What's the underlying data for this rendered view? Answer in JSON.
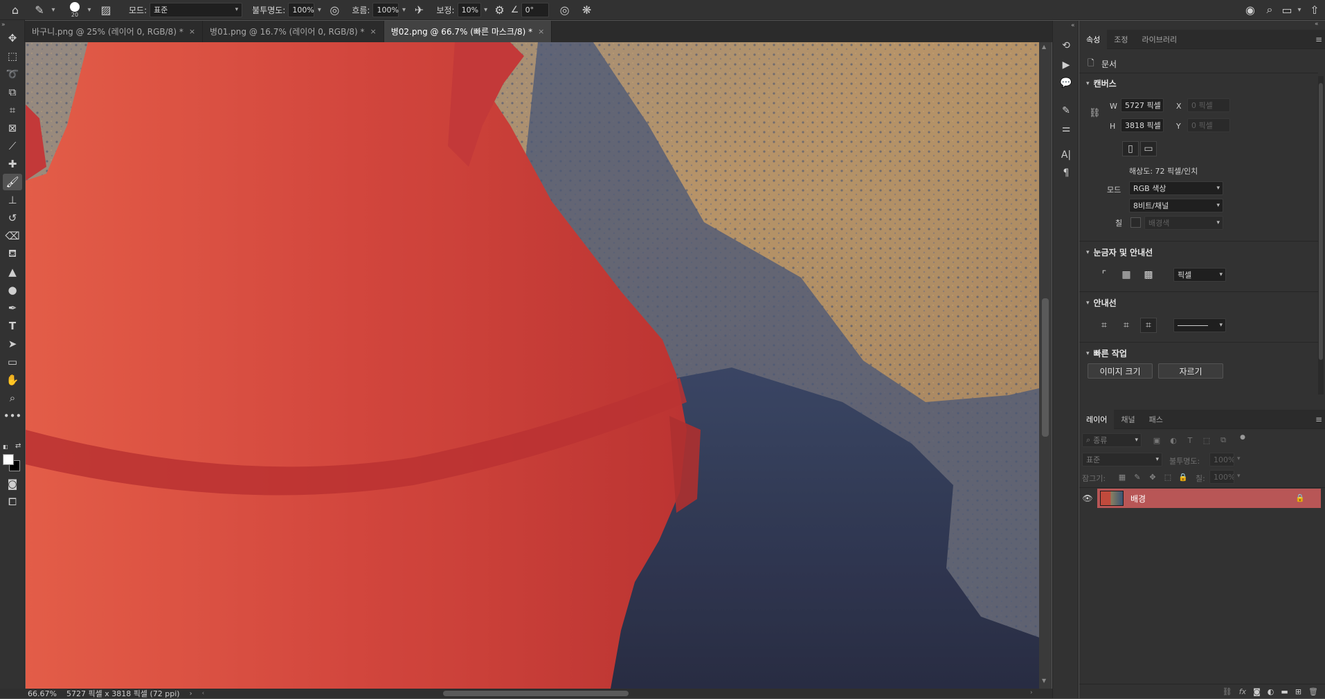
{
  "options_bar": {
    "brush_size": "20",
    "mode_label": "모드:",
    "mode_value": "표준",
    "opacity_label": "불투명도:",
    "opacity_value": "100%",
    "flow_label": "흐름:",
    "flow_value": "100%",
    "smoothing_label": "보정:",
    "smoothing_value": "10%",
    "angle_value": "0°"
  },
  "tabs": [
    {
      "label": "바구니.png @ 25% (레이어 0, RGB/8) *",
      "close": "×"
    },
    {
      "label": "병01.png @ 16.7% (레이어 0, RGB/8) *",
      "close": "×"
    },
    {
      "label": "병02.png @ 66.7% (빠른 마스크/8) *",
      "close": "×"
    }
  ],
  "status_bar": {
    "zoom": "66.67%",
    "doc_info": "5727 픽셀 x 3818 픽셀 (72 ppi)"
  },
  "properties_panel": {
    "tabs": [
      "속성",
      "조정",
      "라이브러리"
    ],
    "doc_label": "문서",
    "canvas": {
      "title": "캔버스",
      "w_label": "W",
      "w_value": "5727 픽셀",
      "h_label": "H",
      "h_value": "3818 픽셀",
      "x_label": "X",
      "x_placeholder": "0 픽셀",
      "y_label": "Y",
      "y_placeholder": "0 픽셀",
      "resolution": "해상도: 72 픽셀/인치",
      "mode_label": "모드",
      "mode_value": "RGB 색상",
      "bits_value": "8비트/채널",
      "fill_label": "칠",
      "fill_value": "배경색"
    },
    "rulers": {
      "title": "눈금자 및 안내선",
      "unit": "픽셀"
    },
    "guides": {
      "title": "안내선"
    },
    "quick_actions": {
      "title": "빠른 작업",
      "image_size_button": "이미지 크기",
      "crop_button": "자르기"
    }
  },
  "layers_panel": {
    "tabs": [
      "레이어",
      "채널",
      "패스"
    ],
    "filter_placeholder": "종류",
    "blend_mode": "표준",
    "opacity_label": "불투명도:",
    "opacity_value": "100%",
    "lock_label": "잠그기:",
    "fill_label": "칠:",
    "fill_value": "100%",
    "layers": [
      {
        "name": "배경",
        "visible": true,
        "locked": true
      }
    ]
  },
  "colors": {
    "chrome_dark": "#323232",
    "canvas_bg": "#535353",
    "layer_selected": "#b85656"
  }
}
